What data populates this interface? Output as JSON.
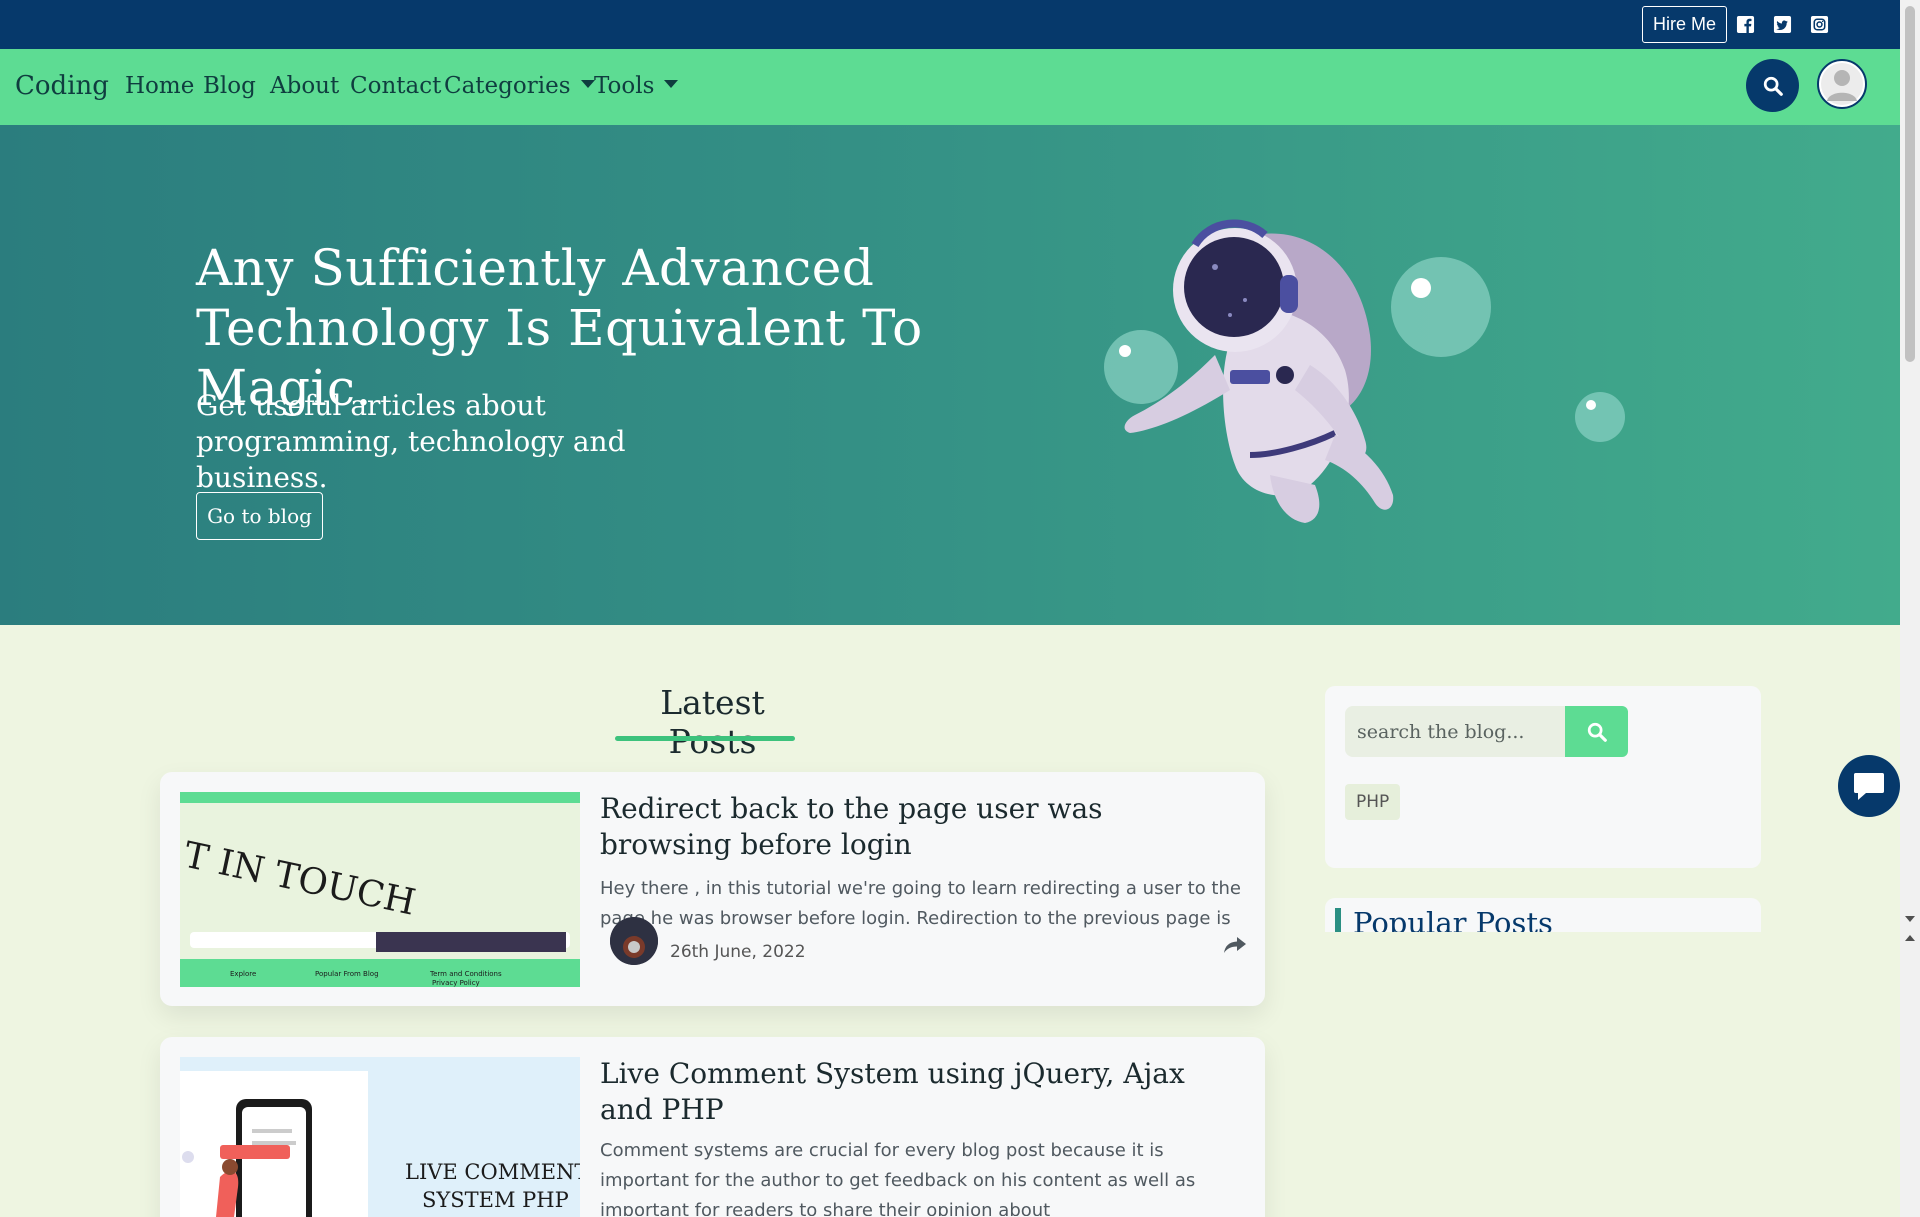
{
  "topbar": {
    "hire_label": "Hire Me",
    "socials": [
      "facebook-icon",
      "twitter-icon",
      "instagram-icon"
    ]
  },
  "navbar": {
    "brand": "Coding",
    "items": [
      {
        "label": "Home"
      },
      {
        "label": "Blog"
      },
      {
        "label": "About"
      },
      {
        "label": "Contact"
      },
      {
        "label": "Categories",
        "dropdown": true
      },
      {
        "label": "Tools",
        "dropdown": true
      }
    ]
  },
  "hero": {
    "title": "Any Sufficiently Advanced Technology Is Equivalent To Magic.",
    "subtitle": "Get useful articles about programming, technology and business.",
    "cta": "Go to blog"
  },
  "latest": {
    "heading": "Latest Posts",
    "posts": [
      {
        "title": "Redirect back to the page user was browsing before login",
        "excerpt": "Hey there , in this tutorial we're going to learn redirecting a user to the page he was browser before login. Redirection to the previous page is",
        "date": "26th June, 2022",
        "thumb_text": "T IN TOUCH",
        "thumb_footer": [
          "Explore",
          "Popular From Blog",
          "Term and Conditions",
          "Privacy Policy"
        ]
      },
      {
        "title": "Live Comment System using jQuery, Ajax and PHP",
        "excerpt": "Comment systems are crucial for every blog post because it is important for the author to get feedback on his content as well as important for readers to share their opinion about",
        "thumb_text_1": "LIVE COMMENT",
        "thumb_text_2": "SYSTEM PHP"
      }
    ]
  },
  "sidebar": {
    "search_placeholder": "search the blog...",
    "tags": [
      "PHP"
    ],
    "popular_heading": "Popular Posts"
  },
  "colors": {
    "navy": "#06396b",
    "green": "#5ddc93",
    "hero_start": "#2b7d7e",
    "hero_end": "#42ab8c",
    "page_bg": "#eef5e1"
  }
}
